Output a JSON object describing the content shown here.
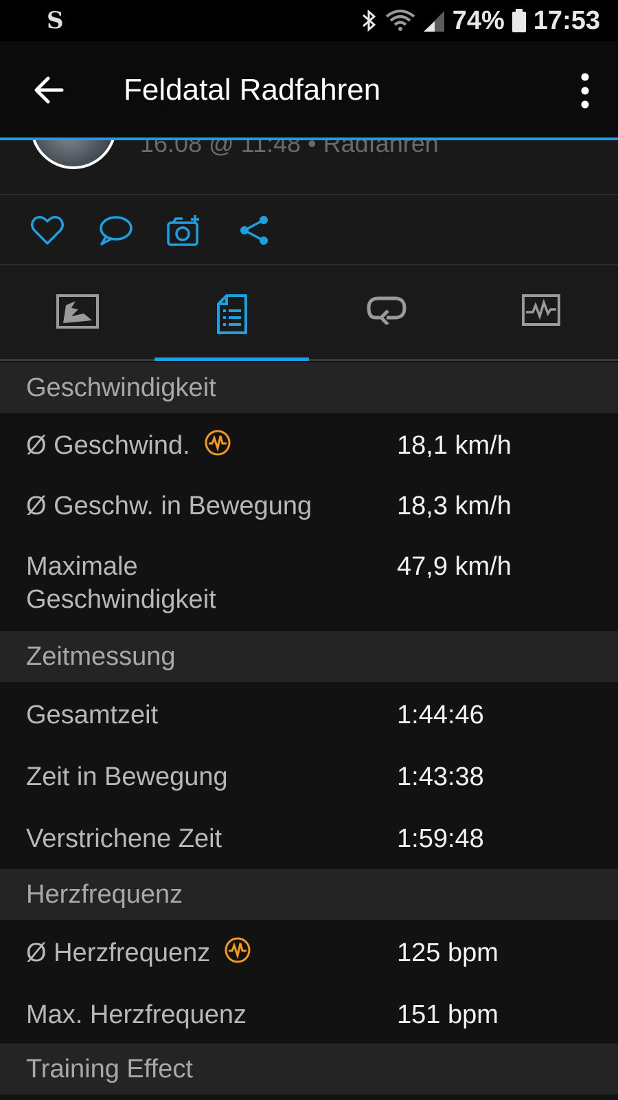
{
  "status_bar": {
    "app_icon": "S",
    "icons": [
      "bluetooth-icon",
      "wifi-icon",
      "signal-icon"
    ],
    "battery": "74%",
    "time": "17:53"
  },
  "toolbar": {
    "title": "Feldatal Radfahren",
    "back_icon": "arrow-left-icon",
    "menu_icon": "more-vert-icon"
  },
  "activity_header": {
    "subtitle": "16.08 @ 11:48 • Radfahren"
  },
  "actions": [
    "heart-icon",
    "comment-icon",
    "add-photo-icon",
    "share-icon"
  ],
  "tabs": [
    {
      "icon": "map-icon",
      "active": false
    },
    {
      "icon": "details-list-icon",
      "active": true
    },
    {
      "icon": "laps-icon",
      "active": false
    },
    {
      "icon": "chart-icon",
      "active": false
    }
  ],
  "accent_color": "#1ba1e2",
  "highlight_color": "#f39a1e",
  "sections": {
    "speed": {
      "title": "Geschwindigkeit",
      "rows": [
        {
          "label": "Ø Geschwind.",
          "value": "18,1 km/h"
        },
        {
          "label": "Ø Geschw. in Bewegung",
          "value": "18,3 km/h"
        },
        {
          "label": "Maximale Geschwindigkeit",
          "value": "47,9 km/h"
        }
      ]
    },
    "timing": {
      "title": "Zeitmessung",
      "rows": [
        {
          "label": "Gesamtzeit",
          "value": "1:44:46"
        },
        {
          "label": "Zeit in Bewegung",
          "value": "1:43:38"
        },
        {
          "label": "Verstrichene Zeit",
          "value": "1:59:48"
        }
      ]
    },
    "heart": {
      "title": "Herzfrequenz",
      "rows": [
        {
          "label": "Ø Herzfrequenz",
          "value": "125 bpm"
        },
        {
          "label": "Max. Herzfrequenz",
          "value": "151 bpm"
        }
      ]
    },
    "training": {
      "title": "Training Effect"
    }
  }
}
